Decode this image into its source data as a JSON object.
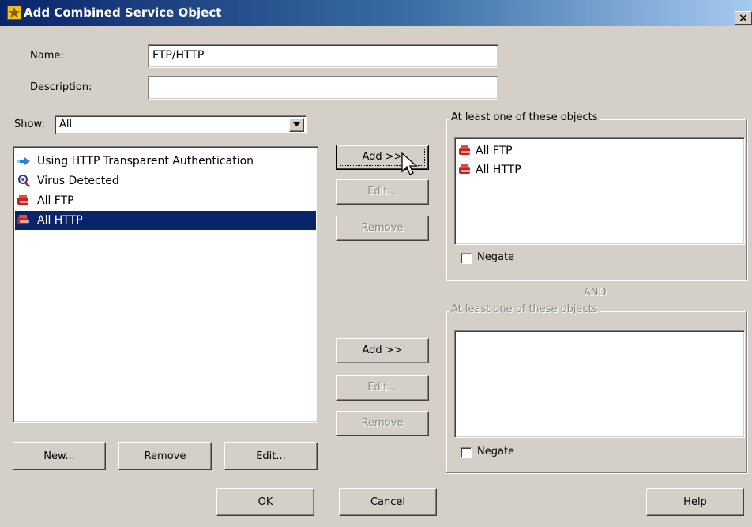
{
  "window": {
    "title": "Add Combined Service Object",
    "close_glyph": "×"
  },
  "form": {
    "name_label": "Name:",
    "name_value": "FTP/HTTP",
    "description_label": "Description:",
    "description_value": "",
    "show_label": "Show:",
    "show_value": "All"
  },
  "source_list": {
    "items": [
      {
        "label": "Using HTTP Transparent Authentication",
        "icon": "blue-arrow-icon",
        "selected": false
      },
      {
        "label": "Virus Detected",
        "icon": "magnifier-virus-icon",
        "selected": false
      },
      {
        "label": "All FTP",
        "icon": "red-service-icon",
        "selected": false
      },
      {
        "label": "All HTTP",
        "icon": "red-service-icon",
        "selected": true
      }
    ]
  },
  "left_buttons": {
    "new": "New...",
    "remove": "Remove",
    "edit": "Edit..."
  },
  "group1": {
    "title": "At least one of these objects",
    "items": [
      {
        "label": "All FTP",
        "icon": "red-service-icon"
      },
      {
        "label": "All HTTP",
        "icon": "red-service-icon"
      }
    ],
    "negate_label": "Negate",
    "negate_checked": false,
    "add": "Add >>",
    "edit": "Edit...",
    "remove": "Remove"
  },
  "and_label": "AND",
  "group2": {
    "title": "At least one of these objects",
    "items": [],
    "negate_label": "Negate",
    "negate_checked": false,
    "add": "Add >>",
    "edit": "Edit...",
    "remove": "Remove"
  },
  "footer": {
    "ok": "OK",
    "cancel": "Cancel",
    "help": "Help"
  }
}
